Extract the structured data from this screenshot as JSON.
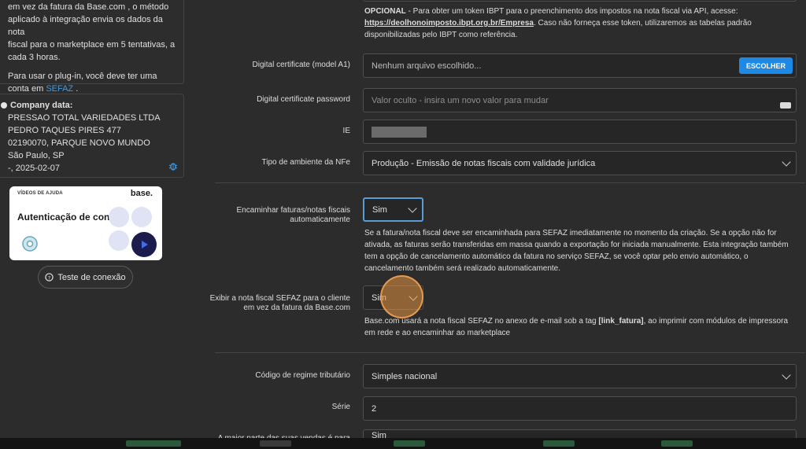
{
  "sidebar": {
    "info_lines": [
      "em vez da fatura da Base.com , o método",
      "aplicado à integração envia os dados da nota",
      "fiscal para o marketplace em 5 tentativas, a",
      "cada 3 horas."
    ],
    "plugin_text": "Para usar o plug-in, você deve ter uma conta em",
    "plugin_link": "SEFAZ",
    "plugin_suffix": " .",
    "company": {
      "title": "Company data:",
      "lines": [
        "PRESSAO TOTAL VARIEDADES LTDA",
        "PEDRO TAQUES PIRES 477",
        "02190070, PARQUE NOVO MUNDO",
        "São Paulo, SP",
        "-, 2025-02-07"
      ]
    },
    "video": {
      "tag": "VÍDEOS DE AJUDA",
      "logo": "base.",
      "title": "Autenticação de conta"
    },
    "test_button": "Teste de conexão"
  },
  "form": {
    "ibpt_help": {
      "prefix": "OPCIONAL",
      "text1": " - Para obter um token IBPT para o preenchimento dos impostos na nota fiscal via API, acesse:",
      "link": "https://deolhonoimposto.ibpt.org.br/Empresa",
      "text2": ". Caso não forneça esse token, utilizaremos as tabelas padrão",
      "text3": "disponibilizadas pelo IBPT como referência."
    },
    "cert": {
      "label": "Digital certificate (model A1)",
      "placeholder": "Nenhum arquivo escolhido...",
      "button": "ESCOLHER"
    },
    "password": {
      "label": "Digital certificate password",
      "placeholder": "Valor oculto - insira um novo valor para mudar"
    },
    "ie": {
      "label": "IE"
    },
    "ambiente": {
      "label": "Tipo de ambiente da NFe",
      "value": "Produção - Emissão de notas fiscais com validade jurídica"
    },
    "encaminhar": {
      "label1": "Encaminhar faturas/notas fiscais",
      "label2": "automaticamente",
      "value": "Sim",
      "help": [
        "Se a fatura/nota fiscal deve ser encaminhada para SEFAZ imediatamente no momento da criação. Se a opção não for",
        "ativada, as faturas serão transferidas em massa quando a exportação for iniciada manualmente. Esta integração também",
        "tem a opção de cancelamento automático da fatura no serviço SEFAZ, se você optar pelo envio automático, o",
        "cancelamento também será realizado automaticamente."
      ]
    },
    "exibir": {
      "label1": "Exibir a nota fiscal SEFAZ para o cliente",
      "label2": "em vez da fatura da Base.com",
      "value": "Sim",
      "help_pre": "Base.com usará a nota fiscal SEFAZ no anexo de e-mail sob a tag ",
      "help_tag": "[link_fatura]",
      "help_post": ", ao imprimir com módulos de impressora",
      "help2": "em rede e ao encaminhar ao marketplace"
    },
    "regime": {
      "label": "Código de regime tributário",
      "value": "Simples nacional"
    },
    "serie": {
      "label": "Série",
      "value": "2"
    },
    "vendas": {
      "label": "A maior parte das suas vendas é para",
      "value": "Sim"
    }
  }
}
